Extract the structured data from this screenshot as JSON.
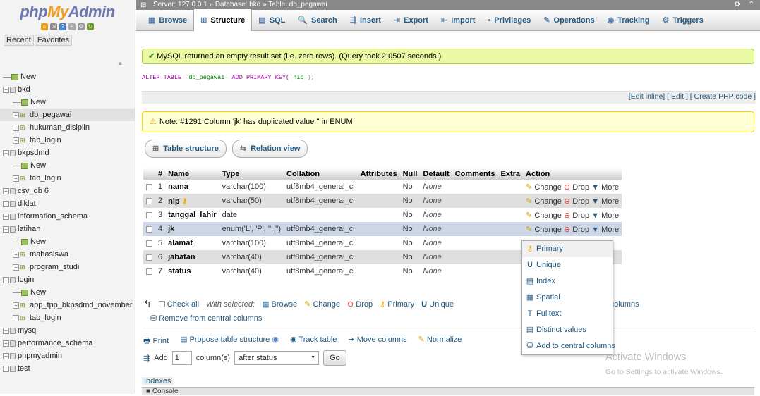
{
  "logo": {
    "php": "php",
    "my": "My",
    "admin": "Admin"
  },
  "sidebar": {
    "recent": "Recent",
    "favorites": "Favorites",
    "tree": [
      {
        "label": "New",
        "level": 0,
        "type": "new"
      },
      {
        "label": "bkd",
        "level": 0,
        "type": "db",
        "expanded": true
      },
      {
        "label": "New",
        "level": 1,
        "type": "new"
      },
      {
        "label": "db_pegawai",
        "level": 1,
        "type": "tbl",
        "selected": true
      },
      {
        "label": "hukuman_disiplin",
        "level": 1,
        "type": "tbl"
      },
      {
        "label": "tab_login",
        "level": 1,
        "type": "tbl"
      },
      {
        "label": "bkpsdmd",
        "level": 0,
        "type": "db",
        "expanded": true
      },
      {
        "label": "New",
        "level": 1,
        "type": "new"
      },
      {
        "label": "tab_login",
        "level": 1,
        "type": "tbl"
      },
      {
        "label": "csv_db 6",
        "level": 0,
        "type": "db"
      },
      {
        "label": "diklat",
        "level": 0,
        "type": "db"
      },
      {
        "label": "information_schema",
        "level": 0,
        "type": "db"
      },
      {
        "label": "latihan",
        "level": 0,
        "type": "db",
        "expanded": true
      },
      {
        "label": "New",
        "level": 1,
        "type": "new"
      },
      {
        "label": "mahasiswa",
        "level": 1,
        "type": "tbl"
      },
      {
        "label": "program_studi",
        "level": 1,
        "type": "tbl"
      },
      {
        "label": "login",
        "level": 0,
        "type": "db",
        "expanded": true
      },
      {
        "label": "New",
        "level": 1,
        "type": "new"
      },
      {
        "label": "app_tpp_bkpsdmd_november",
        "level": 1,
        "type": "tbl"
      },
      {
        "label": "tab_login",
        "level": 1,
        "type": "tbl"
      },
      {
        "label": "mysql",
        "level": 0,
        "type": "db"
      },
      {
        "label": "performance_schema",
        "level": 0,
        "type": "db"
      },
      {
        "label": "phpmyadmin",
        "level": 0,
        "type": "db"
      },
      {
        "label": "test",
        "level": 0,
        "type": "db"
      }
    ]
  },
  "breadcrumb": "Server: 127.0.0.1 » Database: bkd » Table: db_pegawai",
  "tabs": [
    {
      "label": "Browse",
      "icon": "▦"
    },
    {
      "label": "Structure",
      "icon": "⊞",
      "active": true
    },
    {
      "label": "SQL",
      "icon": "▤"
    },
    {
      "label": "Search",
      "icon": "🔍"
    },
    {
      "label": "Insert",
      "icon": "⇶"
    },
    {
      "label": "Export",
      "icon": "⇥"
    },
    {
      "label": "Import",
      "icon": "⇤"
    },
    {
      "label": "Privileges",
      "icon": "▪"
    },
    {
      "label": "Operations",
      "icon": "✎"
    },
    {
      "label": "Tracking",
      "icon": "◉"
    },
    {
      "label": "Triggers",
      "icon": "⚙"
    }
  ],
  "messages": {
    "success": "MySQL returned an empty result set (i.e. zero rows). (Query took 2.0507 seconds.)",
    "sql_alter": "ALTER TABLE",
    "sql_table": "`db_pegawai`",
    "sql_add": "ADD PRIMARY KEY(",
    "sql_col": "`nip`",
    "sql_end": ");",
    "edit_links": "[Edit inline] [ Edit ] [ Create PHP code ]",
    "note": "Note: #1291 Column 'jk' has duplicated value '' in ENUM"
  },
  "subtabs": [
    "Table structure",
    "Relation view"
  ],
  "table": {
    "headers": [
      "#",
      "Name",
      "Type",
      "Collation",
      "Attributes",
      "Null",
      "Default",
      "Comments",
      "Extra",
      "Action"
    ],
    "rows": [
      {
        "n": "1",
        "name": "nama",
        "type": "varchar(100)",
        "collation": "utf8mb4_general_ci",
        "attributes": "",
        "null": "No",
        "default": "None",
        "key": false
      },
      {
        "n": "2",
        "name": "nip",
        "type": "varchar(50)",
        "collation": "utf8mb4_general_ci",
        "attributes": "",
        "null": "No",
        "default": "None",
        "key": true
      },
      {
        "n": "3",
        "name": "tanggal_lahir",
        "type": "date",
        "collation": "",
        "attributes": "",
        "null": "No",
        "default": "None",
        "key": false
      },
      {
        "n": "4",
        "name": "jk",
        "type": "enum('L', 'P', '', '')",
        "collation": "utf8mb4_general_ci",
        "attributes": "",
        "null": "No",
        "default": "None",
        "key": false
      },
      {
        "n": "5",
        "name": "alamat",
        "type": "varchar(100)",
        "collation": "utf8mb4_general_ci",
        "attributes": "",
        "null": "No",
        "default": "None",
        "key": false
      },
      {
        "n": "6",
        "name": "jabatan",
        "type": "varchar(40)",
        "collation": "utf8mb4_general_ci",
        "attributes": "",
        "null": "No",
        "default": "None",
        "key": false
      },
      {
        "n": "7",
        "name": "status",
        "type": "varchar(40)",
        "collation": "utf8mb4_general_ci",
        "attributes": "",
        "null": "No",
        "default": "None",
        "key": false
      }
    ],
    "actions": {
      "change": "Change",
      "drop": "Drop",
      "more": "More"
    }
  },
  "with_selected": {
    "check_all": "Check all",
    "label": "With selected:",
    "browse": "Browse",
    "change": "Change",
    "drop": "Drop",
    "primary": "Primary",
    "unique": "Unique",
    "t": "t",
    "add_central": "Add to central columns",
    "remove_central": "Remove from central columns"
  },
  "printbar": {
    "print": "Print",
    "propose": "Propose table structure",
    "track": "Track table",
    "move": "Move columns",
    "normalize": "Normalize"
  },
  "addrow": {
    "add": "Add",
    "count": "1",
    "columns": "column(s)",
    "position": "after status",
    "go": "Go"
  },
  "more_menu": [
    "Primary",
    "Unique",
    "Index",
    "Spatial",
    "Fulltext",
    "Distinct values",
    "Add to central columns"
  ],
  "footer": {
    "indexes": "Indexes",
    "console": "Console"
  },
  "watermark": {
    "line1": "Activate Windows",
    "line2": "Go to Settings to activate Windows."
  }
}
